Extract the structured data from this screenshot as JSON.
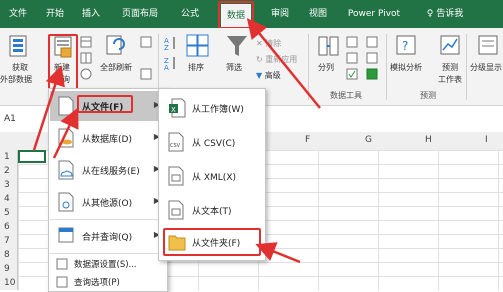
{
  "tabs": [
    {
      "label": "文件",
      "active": false
    },
    {
      "label": "开始",
      "active": false
    },
    {
      "label": "插入",
      "active": false
    },
    {
      "label": "页面布局",
      "active": false
    },
    {
      "label": "公式",
      "active": false
    },
    {
      "label": "数据",
      "active": true
    },
    {
      "label": "审阅",
      "active": false
    },
    {
      "label": "视图",
      "active": false
    },
    {
      "label": "Power Pivot",
      "active": false
    },
    {
      "label": "告诉我",
      "active": false
    }
  ],
  "ribbon": {
    "get_data": [
      "获取",
      "外部数据"
    ],
    "new_query": [
      "新建",
      "查询"
    ],
    "refresh_all": "全部刷新",
    "sort": "排序",
    "filter": "筛选",
    "clear": "清除",
    "reapply": "重新应用",
    "advanced": "高级",
    "split": "分列",
    "what_if": "模拟分析",
    "forecast_sheet": [
      "预测",
      "工作表"
    ],
    "outline": "分级显示",
    "group_data_tools": "数据工具",
    "group_forecast": "预测"
  },
  "formula_bar": {
    "name_box": "A1"
  },
  "columns": [
    "F",
    "G",
    "H",
    "I"
  ],
  "rows": [
    "1",
    "2",
    "3",
    "4",
    "5",
    "6",
    "7",
    "8",
    "9",
    "10"
  ],
  "menu_new_query": {
    "items": [
      {
        "label": "从文件(F)",
        "has_submenu": true
      },
      {
        "label": "从数据库(D)",
        "has_submenu": true
      },
      {
        "label": "从在线服务(E)",
        "has_submenu": true
      },
      {
        "label": "从其他源(O)",
        "has_submenu": true
      },
      {
        "label": "合并查询(Q)",
        "has_submenu": true
      }
    ],
    "small_items": [
      {
        "label": "数据源设置(S)..."
      },
      {
        "label": "查询选项(P)"
      }
    ]
  },
  "menu_from_file": {
    "items": [
      {
        "label": "从工作簿(W)"
      },
      {
        "label": "从 CSV(C)"
      },
      {
        "label": "从 XML(X)"
      },
      {
        "label": "从文本(T)"
      },
      {
        "label": "从文件夹(F)"
      }
    ]
  },
  "colors": {
    "excel_green": "#217346",
    "highlight_red": "#e0302f",
    "menu_hover": "#c7c7c7"
  }
}
